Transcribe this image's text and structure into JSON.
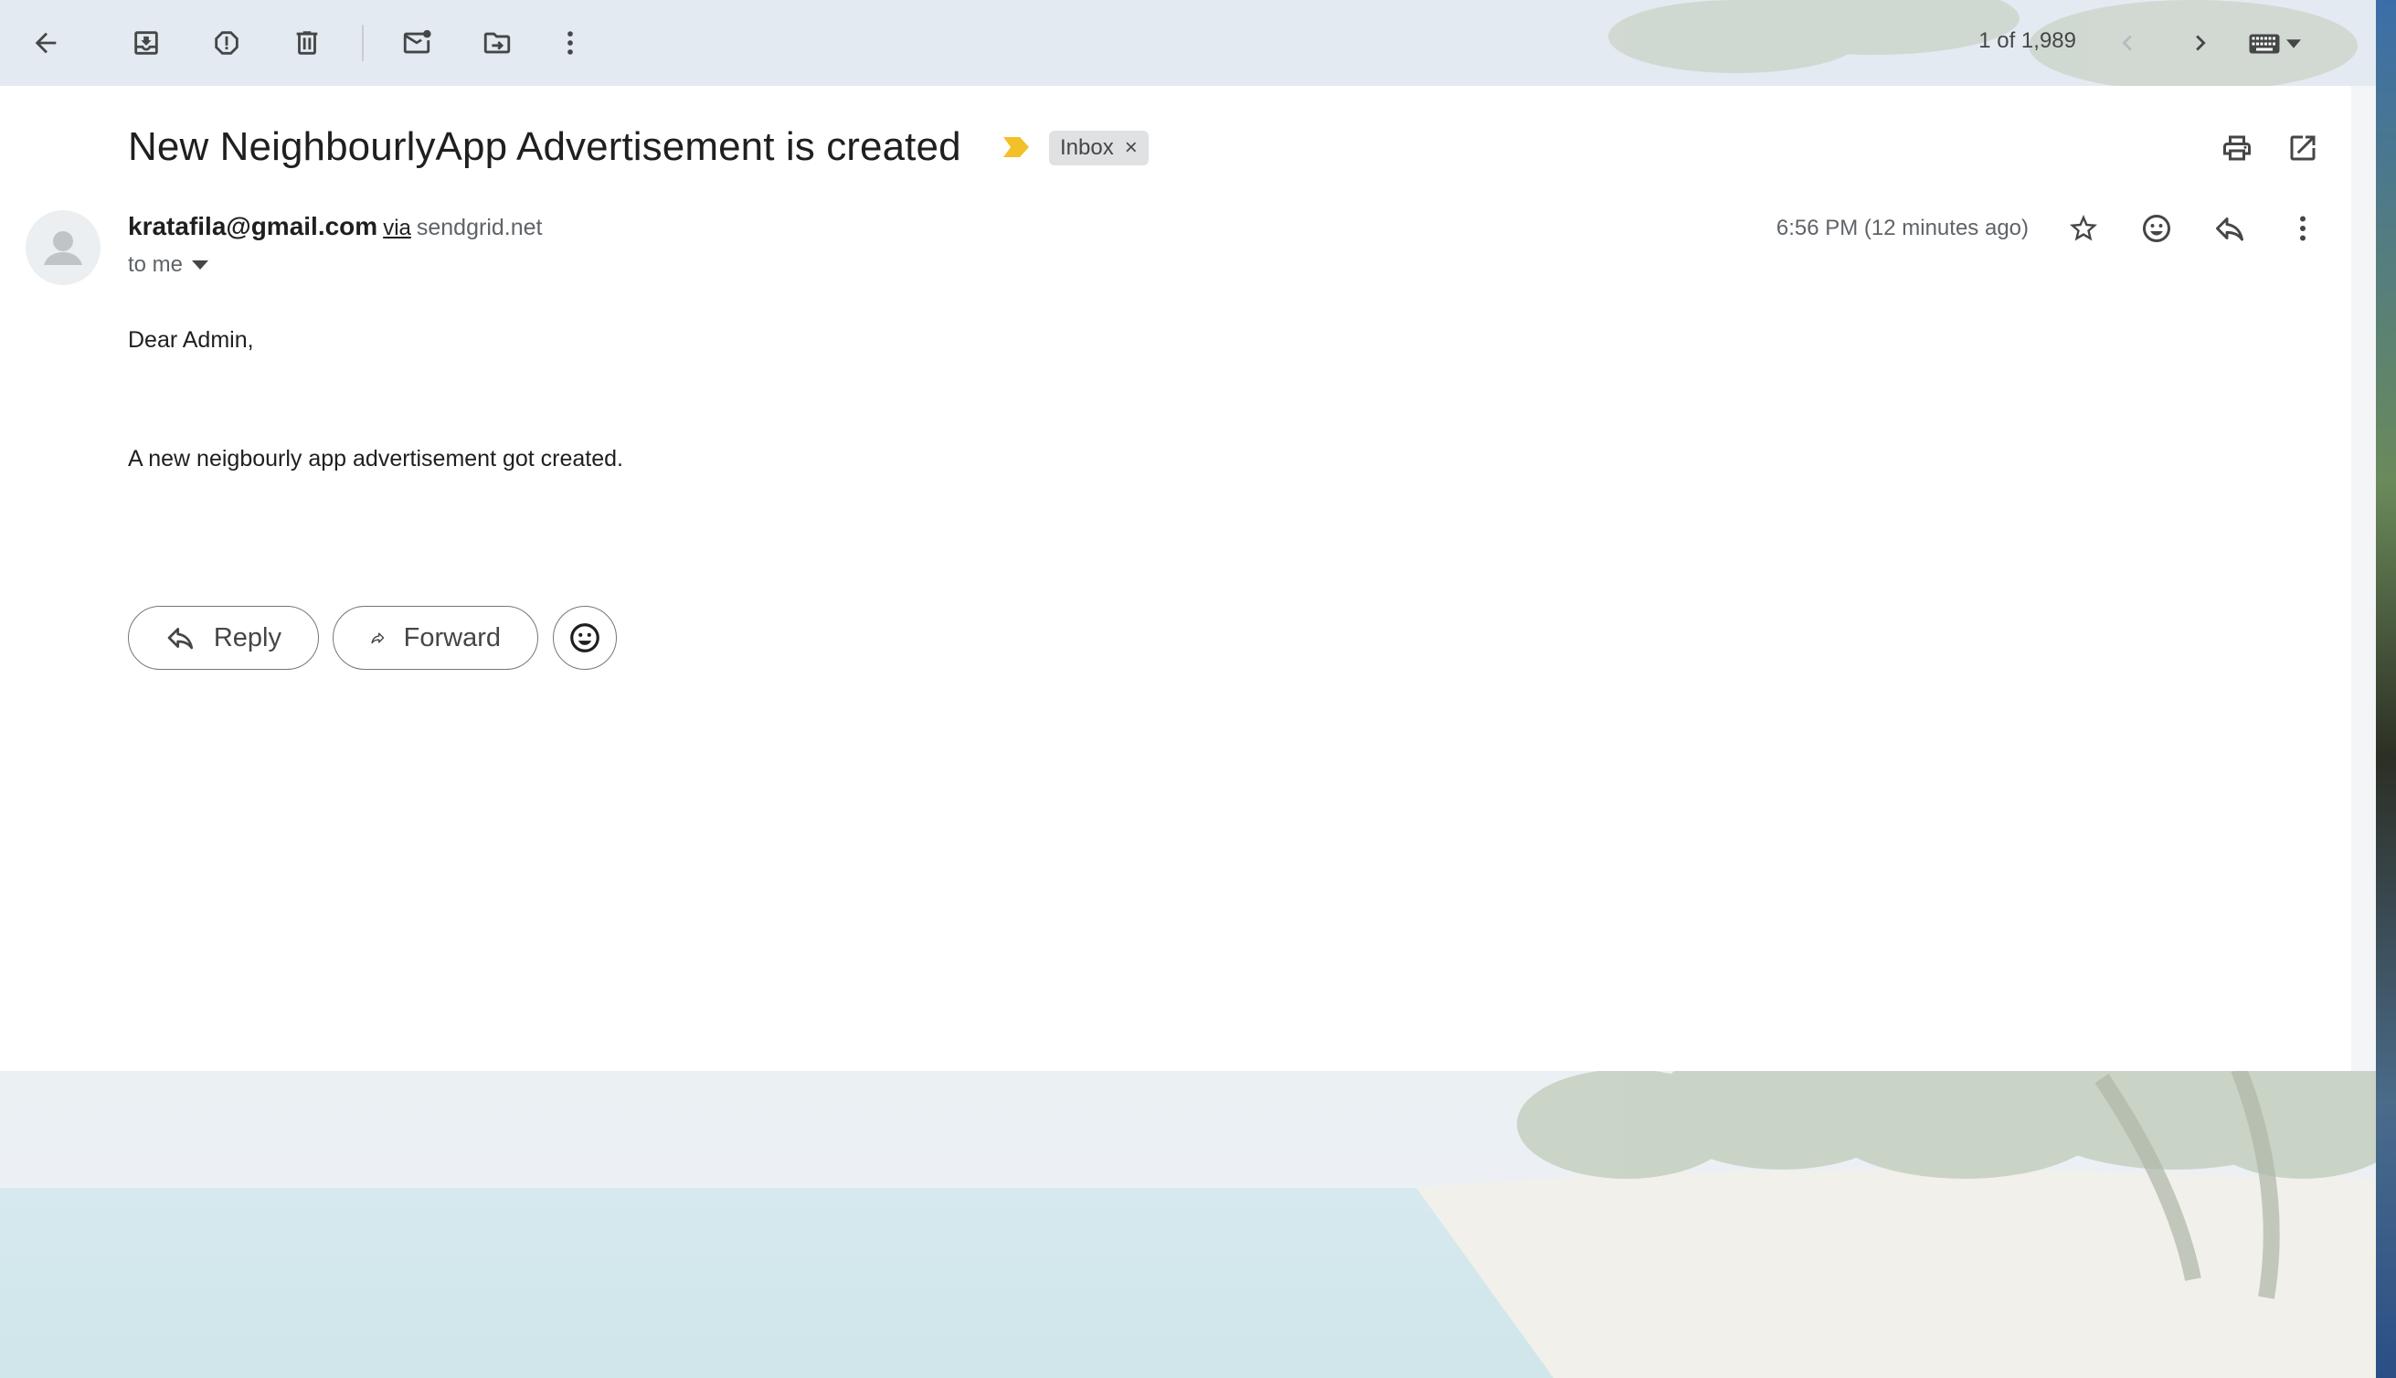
{
  "colors": {
    "accent_importance": "#f2c028",
    "label_bg": "#dfe1e3",
    "icon": "#444746",
    "text_muted": "#5f6368"
  },
  "toolbar": {
    "back_icon": "arrow-left-icon",
    "archive_icon": "archive-icon",
    "spam_icon": "report-spam-icon",
    "delete_icon": "trash-icon",
    "mark_unread_icon": "mark-unread-icon",
    "move_icon": "move-to-folder-icon",
    "more_icon": "more-vertical-icon",
    "counter": "1 of 1,989",
    "prev_icon": "chevron-left-icon",
    "next_icon": "chevron-right-icon",
    "keyboard_icon": "keyboard-icon"
  },
  "email": {
    "subject": "New NeighbourlyApp Advertisement is created",
    "label": "Inbox",
    "label_remove": "×",
    "sender_email": "kratafila@gmail.com",
    "via": "via",
    "via_domain": "sendgrid.net",
    "recipient": "to me",
    "timestamp": "6:56 PM (12 minutes ago)",
    "body_greeting": "Dear Admin,",
    "body_text": "A new neigbourly app advertisement got created."
  },
  "actions": {
    "reply_label": "Reply",
    "forward_label": "Forward"
  }
}
